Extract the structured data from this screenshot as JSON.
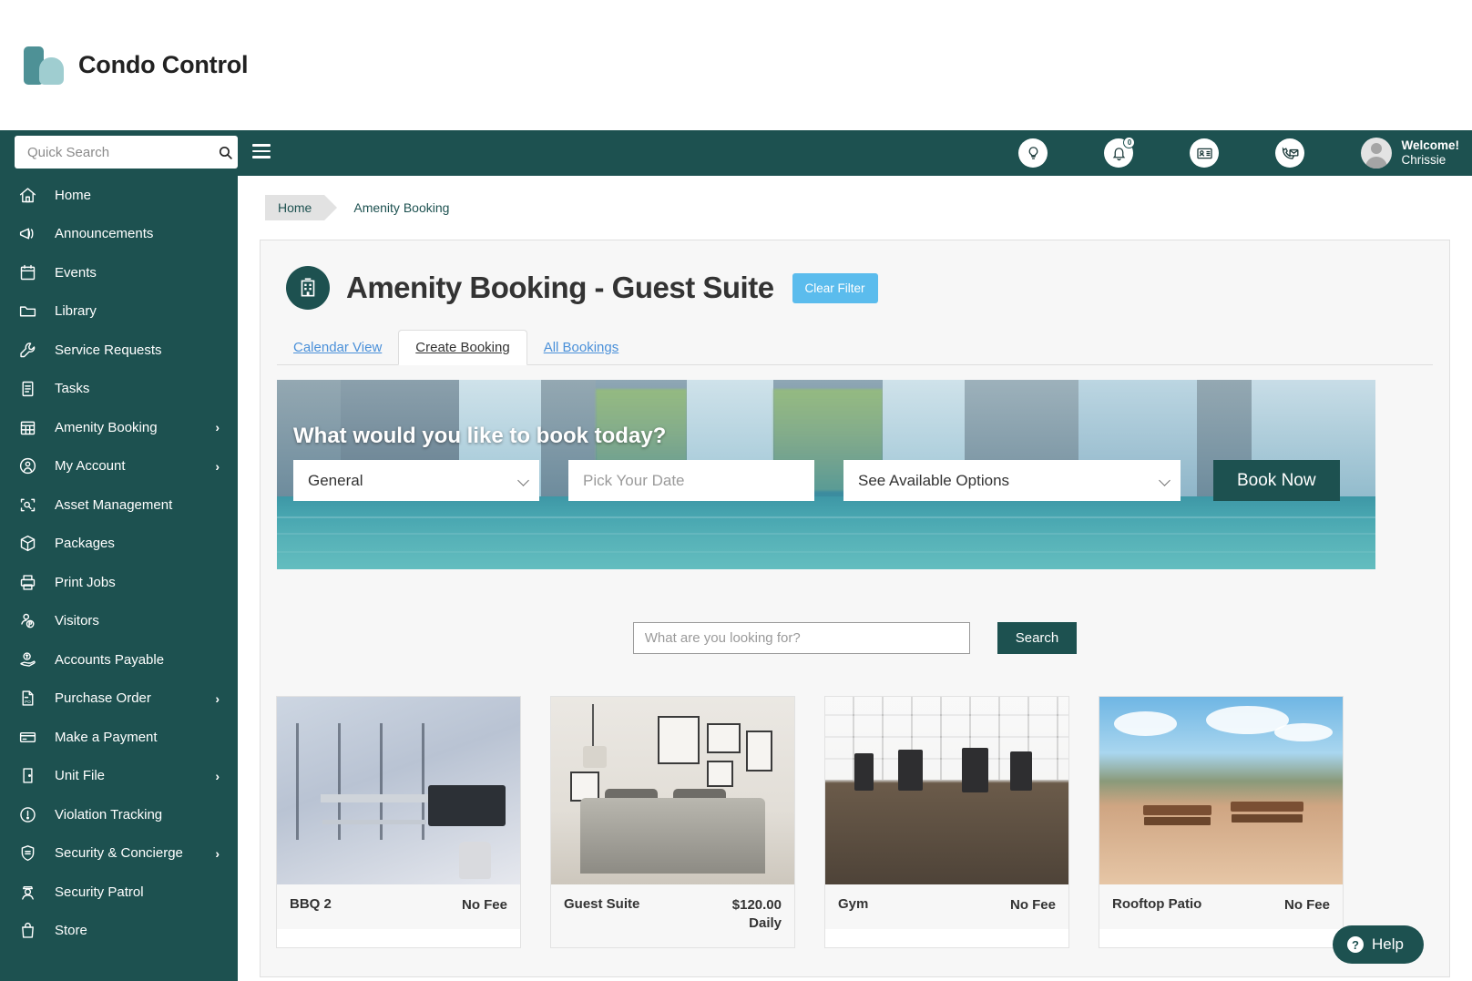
{
  "brand": {
    "name": "Condo Control"
  },
  "topbar": {
    "search_placeholder": "Quick Search",
    "menu_icon": "hamburger-icon",
    "icons": [
      {
        "name": "lightbulb-icon"
      },
      {
        "name": "bell-icon",
        "badge": "0"
      },
      {
        "name": "id-card-icon"
      },
      {
        "name": "phone-envelope-icon"
      }
    ],
    "welcome_line1": "Welcome!",
    "welcome_line2": "Chrissie"
  },
  "sidebar": {
    "items": [
      {
        "label": "Home",
        "icon": "home-icon",
        "caret": false
      },
      {
        "label": "Announcements",
        "icon": "megaphone-icon",
        "caret": false
      },
      {
        "label": "Events",
        "icon": "calendar-24-icon",
        "caret": false
      },
      {
        "label": "Library",
        "icon": "folder-icon",
        "caret": false
      },
      {
        "label": "Service Requests",
        "icon": "wrench-icon",
        "caret": false
      },
      {
        "label": "Tasks",
        "icon": "clipboard-icon",
        "caret": false
      },
      {
        "label": "Amenity Booking",
        "icon": "grid-calendar-icon",
        "caret": true
      },
      {
        "label": "My Account",
        "icon": "user-circle-icon",
        "caret": true
      },
      {
        "label": "Asset Management",
        "icon": "asset-scan-icon",
        "caret": false
      },
      {
        "label": "Packages",
        "icon": "box-icon",
        "caret": false
      },
      {
        "label": "Print Jobs",
        "icon": "printer-icon",
        "caret": false
      },
      {
        "label": "Visitors",
        "icon": "visitor-parking-icon",
        "caret": false
      },
      {
        "label": "Accounts Payable",
        "icon": "hand-money-icon",
        "caret": false
      },
      {
        "label": "Purchase Order",
        "icon": "po-document-icon",
        "caret": true
      },
      {
        "label": "Make a Payment",
        "icon": "credit-card-icon",
        "caret": false
      },
      {
        "label": "Unit File",
        "icon": "door-icon",
        "caret": true
      },
      {
        "label": "Violation Tracking",
        "icon": "exclamation-circle-icon",
        "caret": false
      },
      {
        "label": "Security & Concierge",
        "icon": "shield-icon",
        "caret": true
      },
      {
        "label": "Security Patrol",
        "icon": "guard-icon",
        "caret": false
      },
      {
        "label": "Store",
        "icon": "shopping-bag-icon",
        "caret": false
      }
    ],
    "caret_glyph": "›"
  },
  "breadcrumb": {
    "home": "Home",
    "current": "Amenity Booking"
  },
  "page": {
    "title": "Amenity Booking - Guest Suite",
    "title_icon": "building-icon",
    "clear_filter": "Clear Filter"
  },
  "tabs": [
    {
      "label": "Calendar View",
      "active": false
    },
    {
      "label": "Create Booking",
      "active": true
    },
    {
      "label": "All Bookings",
      "active": false
    }
  ],
  "hero": {
    "question": "What would you like to book today?",
    "category_value": "General",
    "category_options": [
      "General"
    ],
    "date_placeholder": "Pick Your Date",
    "date_value": "",
    "options_value": "See Available Options",
    "options_list": [
      "See Available Options"
    ],
    "book_button": "Book Now"
  },
  "search": {
    "placeholder": "What are you looking for?",
    "value": "",
    "button": "Search"
  },
  "cards": [
    {
      "name": "BBQ 2",
      "fee": "No Fee",
      "fee_sub": "",
      "image": "bbq-patio-photo"
    },
    {
      "name": "Guest Suite",
      "fee": "$120.00",
      "fee_sub": "Daily",
      "image": "guest-suite-bedroom-photo"
    },
    {
      "name": "Gym",
      "fee": "No Fee",
      "fee_sub": "",
      "image": "gym-interior-photo"
    },
    {
      "name": "Rooftop Patio",
      "fee": "No Fee",
      "fee_sub": "",
      "image": "rooftop-patio-photo"
    }
  ],
  "help": {
    "label": "Help",
    "icon": "question-mark-icon"
  },
  "colors": {
    "teal": "#1d5150",
    "accent_blue": "#5bbced",
    "link_blue": "#4a90d9",
    "panel_bg": "#f7f7f7"
  }
}
